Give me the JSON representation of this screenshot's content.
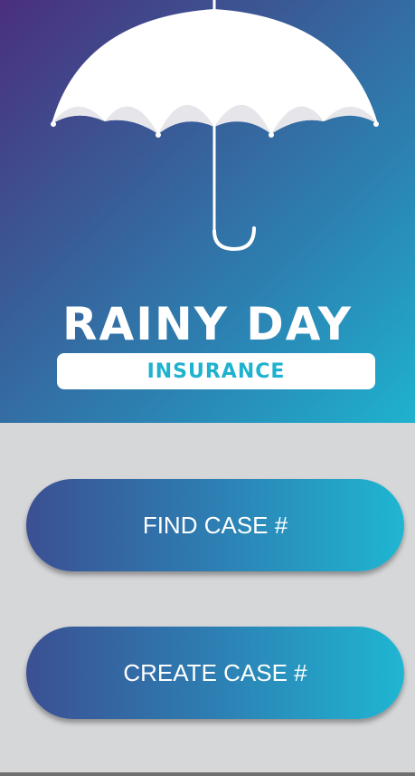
{
  "logo": {
    "title": "RAINY DAY",
    "subtitle": "INSURANCE"
  },
  "actions": {
    "find_label": "FIND CASE #",
    "create_label": "CREATE CASE #"
  },
  "colors": {
    "gradient_start": "#4a2f7d",
    "gradient_end": "#1fb2cf",
    "accent": "#1fb2cf",
    "background": "#d6d7d9"
  },
  "icons": {
    "logo_icon": "umbrella-icon"
  }
}
